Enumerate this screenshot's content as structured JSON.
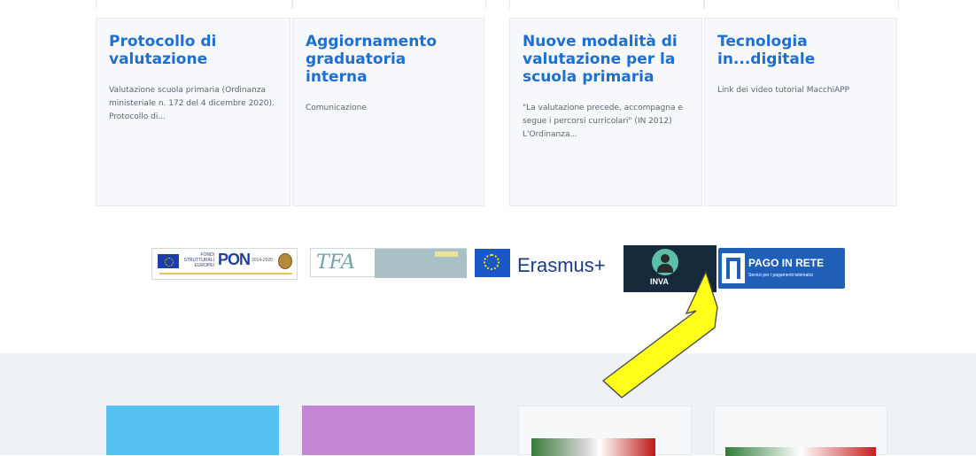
{
  "cards": [
    {
      "title": "Protocollo di valutazione",
      "text": "Valutazione scuola primaria (Ordinanza ministeriale n. 172 del 4 dicembre 2020). Protocollo di..."
    },
    {
      "title": "Aggiornamento graduatoria interna",
      "text": "Comunicazione"
    },
    {
      "title": "Nuove modalità di valutazione per la scuola primaria",
      "text": "\"La valutazione precede, accompagna e segue i percorsi curricolari\" (IN 2012) L'Ordinanza..."
    },
    {
      "title": "Tecnologia in...digitale",
      "text": "Link dei video tutorial MacchiAPP"
    }
  ],
  "logos": {
    "pon": {
      "small1": "FONDI",
      "small2": "STRUTTURALI",
      "small3": "EUROPEI",
      "brand": "PON",
      "years": "2014-2020"
    },
    "tfa": {
      "brand": "TFA"
    },
    "erasmus": {
      "brand": "Erasmus+"
    },
    "invalsi": {
      "brand": "INVA"
    },
    "pago": {
      "brand": "PAGO IN RETE",
      "sub": "Servizi per i pagamenti telematici"
    }
  },
  "colors": {
    "title_blue": "#1d6fd1",
    "footer_bg": "#eef1f6",
    "arrow_yellow": "#ffff1a",
    "tile_cyan": "#55c2f2",
    "tile_purple": "#c386d4"
  },
  "annotation": {
    "icon": "yellow-arrow-icon"
  }
}
